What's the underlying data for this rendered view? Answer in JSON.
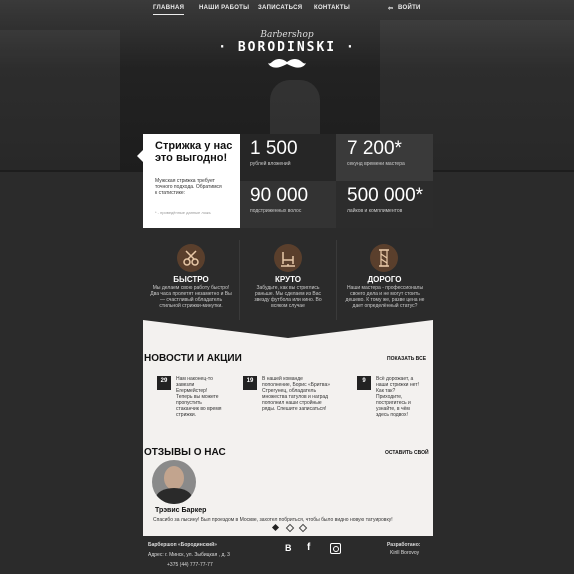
{
  "nav": {
    "items": [
      "ГЛАВНАЯ",
      "НАШИ РАБОТЫ",
      "ЗАПИСАТЬСЯ",
      "КОНТАКТЫ"
    ],
    "login": "ВОЙТИ"
  },
  "brand": {
    "script": "Barbershop",
    "name": "BORODINSKI"
  },
  "promo": {
    "title": "Стрижка у нас это выгодно!",
    "text": "Мужская стрижка требует точного подхода. Обратимся к статистике:",
    "note": "* - приведённые данные ложь"
  },
  "stats": [
    {
      "value": "1 500",
      "label": "рублей вложений"
    },
    {
      "value": "7 200*",
      "label": "секунд времени мастера"
    },
    {
      "value": "90 000",
      "label": "подстриженных волос"
    },
    {
      "value": "500 000*",
      "label": "лайков и комплиментов"
    }
  ],
  "features": [
    {
      "title": "БЫСТРО",
      "text": "Мы делаем свою работу быстро! Два часа пролетят незаметно и Вы — счастливый обладатель стильной стрижки-минутки.",
      "icon": "scissors-icon"
    },
    {
      "title": "КРУТО",
      "text": "Забудьте, как вы стриглись раньше. Мы сделаем из Вас звезду футбола или кино. Во всяком случае",
      "icon": "barber-chair-icon"
    },
    {
      "title": "ДОРОГО",
      "text": "Наши мастера - профессионалы своего дела и не могут стоить дешево. К тому же, разве цена не дает определённый статус?",
      "icon": "barber-pole-icon"
    }
  ],
  "news": {
    "title": "НОВОСТИ И АКЦИИ",
    "show_all": "ПОКАЗАТЬ ВСЕ",
    "items": [
      {
        "day": "29",
        "text": "Нам наконец-то завезли Егермейстер! Теперь вы можете пропустить стаканчик во время стрижки."
      },
      {
        "day": "19",
        "text": "В нашей команде пополнение, Борис «Бритва» Стрегунец, обладатель множества татулов и наград пополнил наши стройные ряды. Спешите записаться!"
      },
      {
        "day": "9",
        "text": "Всё дорожает, а наши стрижки нет! Как так? Приходите, постригитесь и узнайте, в чём здесь подвох!"
      }
    ]
  },
  "reviews": {
    "title": "ОТЗЫВЫ О НАС",
    "leave": "ОСТАВИТЬ СВОЙ",
    "name": "Трэвис Баркер",
    "text": "Спасибо за лысину! Был проездом в Москве, захотел побриться, чтобы было видно новую татуировку!"
  },
  "footer": {
    "name": "Барбершоп «Бородинский»",
    "address": "Адрес: г. Минск, ул. Зыбицкая , д. 3",
    "phone": "+375 (44) 777-77-77",
    "dev_label": "Разработано:",
    "dev_name": "Kirill Borovoy",
    "social": [
      "В",
      "f"
    ]
  }
}
